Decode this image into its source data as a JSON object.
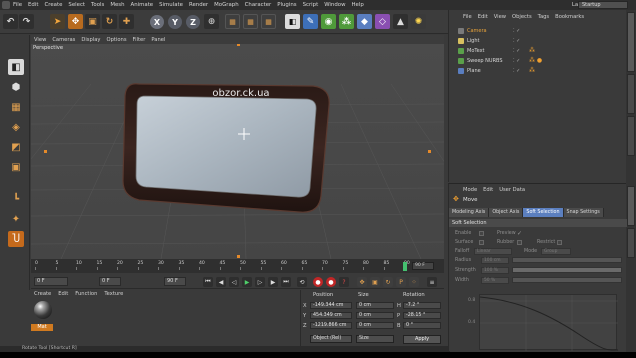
{
  "app": {
    "menu": [
      "File",
      "Edit",
      "Create",
      "Select",
      "Tools",
      "Mesh",
      "Animate",
      "Simulate",
      "Render",
      "MoGraph",
      "Character",
      "Plugins",
      "Script",
      "Window",
      "Help"
    ],
    "layout_label": "Layout:",
    "layout_value": "Startup"
  },
  "toolbar": {
    "axis_x": "X",
    "axis_y": "Y",
    "axis_z": "Z"
  },
  "viewport": {
    "menu": [
      "View",
      "Cameras",
      "Display",
      "Options",
      "Filter",
      "Panel"
    ],
    "label": "Perspective",
    "screen_text": "obzor.ck.ua"
  },
  "timeline": {
    "ticks": [
      "0",
      "5",
      "10",
      "15",
      "20",
      "25",
      "30",
      "35",
      "40",
      "45",
      "50",
      "55",
      "60",
      "65",
      "70",
      "75",
      "80",
      "85",
      "90"
    ],
    "end_frame": "90 F"
  },
  "transport": {
    "current_frame": "0 F",
    "min_frame": "0 F",
    "max_frame": "90 F"
  },
  "material_manager": {
    "menu": [
      "Create",
      "Edit",
      "Function",
      "Texture"
    ],
    "material_name": "Mat"
  },
  "coordinates": {
    "headers": [
      "Position",
      "Size",
      "Rotation"
    ],
    "rows": [
      {
        "axis": "X",
        "position": "-149.344 cm",
        "size": "0 cm",
        "rot_axis": "H",
        "rotation": "-7.2 °"
      },
      {
        "axis": "Y",
        "position": "454.349 cm",
        "size": "0 cm",
        "rot_axis": "P",
        "rotation": "-28.15 °"
      },
      {
        "axis": "Z",
        "position": "-1219.866 cm",
        "size": "0 cm",
        "rot_axis": "B",
        "rotation": "0 °"
      }
    ],
    "mode_select": "Object (Rel)",
    "size_select": "Size",
    "apply": "Apply"
  },
  "object_manager": {
    "menu": [
      "File",
      "Edit",
      "View",
      "Objects",
      "Tags",
      "Bookmarks"
    ],
    "objects": [
      {
        "name": "Camera",
        "color": "#e8a33a",
        "selected": true
      },
      {
        "name": "Light",
        "color": "#d8d8d8",
        "selected": false
      },
      {
        "name": "MoText",
        "color": "#d8d8d8",
        "selected": false
      },
      {
        "name": "Sweep NURBS",
        "color": "#d8d8d8",
        "selected": false
      },
      {
        "name": "Plane",
        "color": "#d8d8d8",
        "selected": false
      }
    ]
  },
  "attribute_manager": {
    "menu": [
      "Mode",
      "Edit",
      "User Data"
    ],
    "title": "Move",
    "tabs": [
      "Modeling Axis",
      "Object Axis",
      "Soft Selection",
      "Snap Settings"
    ],
    "active_tab": "Soft Selection",
    "section": "Soft Selection",
    "fields": {
      "enable": "Enable",
      "preview": "Preview",
      "surface": "Surface",
      "rubber": "Rubber",
      "restrict": "Restrict",
      "falloff": "Falloff",
      "falloff_value": "Linear",
      "mode": "Mode",
      "mode_value": "Group",
      "radius": "Radius",
      "radius_value": "100 cm",
      "strength": "Strength",
      "strength_value": "100 %",
      "width": "Width",
      "width_value": "50 %",
      "graph_y1": "0.8",
      "graph_y2": "0.4"
    }
  },
  "status": {
    "text": "Rotate Tool [Shortcut R]"
  },
  "colors": {
    "accent_orange": "#d07a20",
    "active_tab_blue": "#5b7fbf",
    "playhead_green": "#45c070"
  }
}
